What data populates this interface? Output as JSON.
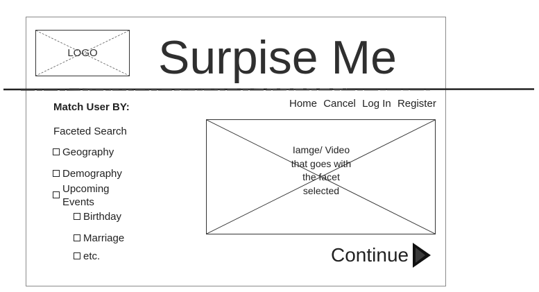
{
  "header": {
    "logo_text": "LOGO",
    "site_title": "Surpise Me"
  },
  "nav": {
    "items": [
      "Home",
      "Cancel",
      "Log In",
      "Register"
    ]
  },
  "sidebar": {
    "match_heading": "Match User BY:",
    "faceted_label": "Faceted Search",
    "facets": {
      "geography": "Geography",
      "demography": "Demography",
      "upcoming_events": "Upcoming Events",
      "birthday": "Birthday",
      "marriage": "Marriage",
      "etc": "etc."
    }
  },
  "main": {
    "media_placeholder": "Iamge/ Video that goes with the facet selected",
    "continue_label": "Continue",
    "continue_icon": "play-arrow-icon"
  },
  "colors": {
    "frame_border": "#8a8a8a",
    "text": "#222222",
    "title": "#2f2f2f",
    "arrow": "#111111"
  }
}
